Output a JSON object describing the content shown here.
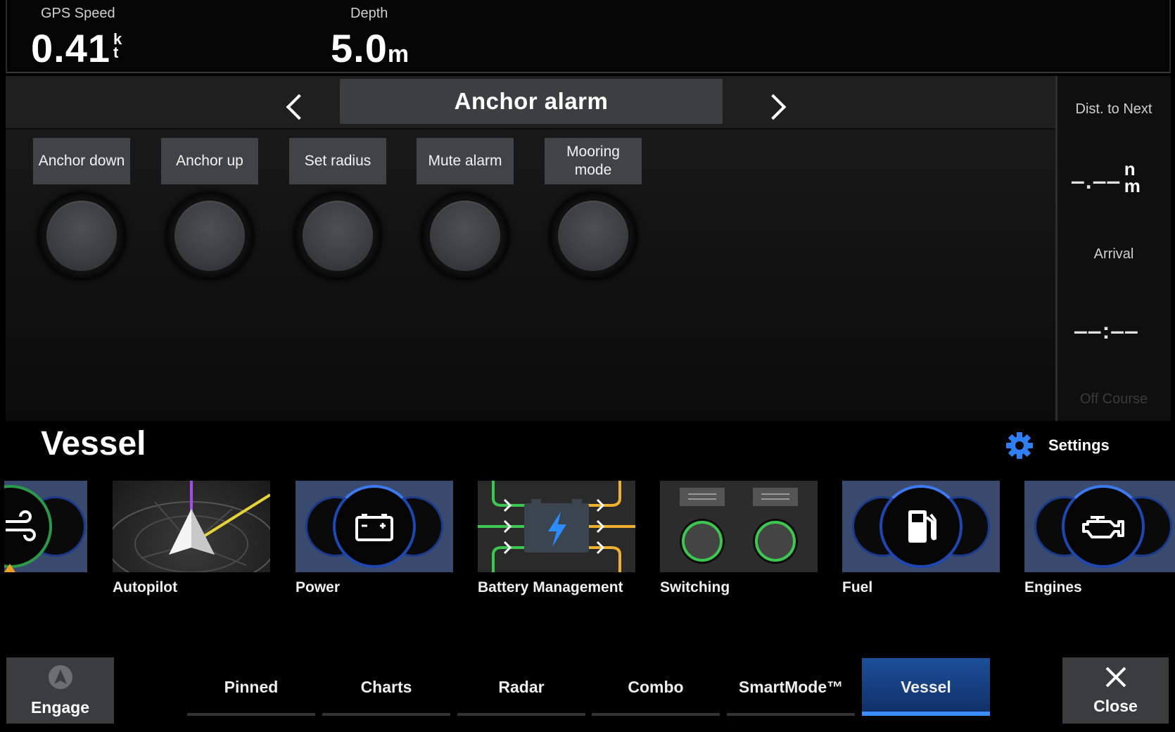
{
  "top_bar": {
    "gps_speed": {
      "label": "GPS Speed",
      "value": "0.41",
      "unit_top": "k",
      "unit_bottom": "t"
    },
    "depth": {
      "label": "Depth",
      "value": "5.0",
      "unit": "m"
    }
  },
  "panel": {
    "title": "Anchor alarm",
    "controls": [
      {
        "label": "Anchor down"
      },
      {
        "label": "Anchor up"
      },
      {
        "label": "Set radius"
      },
      {
        "label": "Mute alarm"
      },
      {
        "label": "Mooring mode"
      }
    ]
  },
  "sidebar": {
    "dist_label": "Dist. to Next",
    "dist_value": "‒.‒‒",
    "dist_unit_top": "n",
    "dist_unit_bottom": "m",
    "arrival_label": "Arrival",
    "arrival_value": "‒‒:‒‒",
    "off_course_label": "Off Course"
  },
  "vessel": {
    "title": "Vessel",
    "settings_label": "Settings",
    "tiles": [
      {
        "label": "Autopilot",
        "icon": "compass-icon"
      },
      {
        "label": "Power",
        "icon": "battery-icon"
      },
      {
        "label": "Battery Management",
        "icon": "battery-management-icon"
      },
      {
        "label": "Switching",
        "icon": "switch-icon"
      },
      {
        "label": "Fuel",
        "icon": "fuel-pump-icon"
      },
      {
        "label": "Engines",
        "icon": "engine-icon"
      }
    ]
  },
  "bottom_bar": {
    "engage_label": "Engage",
    "close_label": "Close",
    "tabs": [
      "Pinned",
      "Charts",
      "Radar",
      "Combo",
      "SmartMode™",
      "Vessel"
    ],
    "active_tab": "Vessel"
  },
  "colors": {
    "accent": "#3a8cff",
    "gauge_blue": "#1f47b0",
    "tile_bg": "#3a4a6e"
  }
}
